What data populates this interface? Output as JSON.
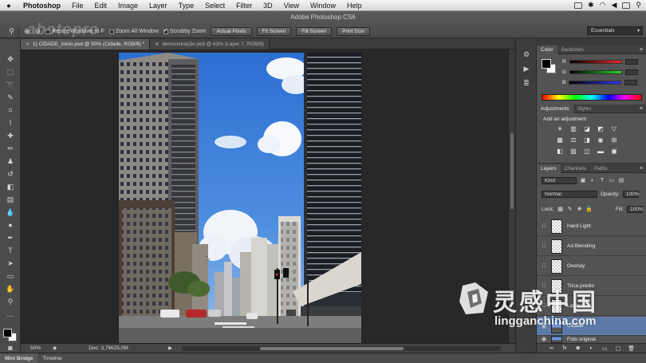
{
  "menubar": {
    "app": "Photoshop",
    "items": [
      "File",
      "Edit",
      "Image",
      "Layer",
      "Type",
      "Select",
      "Filter",
      "3D",
      "View",
      "Window",
      "Help"
    ]
  },
  "titlebar": {
    "title": "Adobe Photoshop CS6"
  },
  "watermark_top": "abotopro",
  "options": {
    "resize_windows": "Resize Windows to F",
    "zoom_all": "Zoom All Window",
    "scrubby": "Scrubby Zoom",
    "actual_pixels": "Actual Pixels",
    "fit_screen": "Fit Screen",
    "fill_screen": "Fill Screen",
    "print_size": "Print Size",
    "workspace": "Essentials"
  },
  "tabs": [
    {
      "label": "1) CIDADE_inicio.psd @ 50% (Cidade, RGB/8) *",
      "active": true
    },
    {
      "label": "demonstração.psd @ 63% (Layer 7, RGB/8)",
      "active": false
    }
  ],
  "status": {
    "zoom": "50%",
    "doc": "Doc: 3,7M/25,0M"
  },
  "bottom_tabs": [
    "Mini Bridge",
    "Timeline"
  ],
  "color_panel": {
    "tabs": [
      "Color",
      "Swatches"
    ],
    "channels": [
      "R",
      "G",
      "B"
    ]
  },
  "adjustments": {
    "tabs": [
      "Adjustments",
      "Styles"
    ],
    "title": "Add an adjustment"
  },
  "layers_panel": {
    "tabs": [
      "Layers",
      "Channels",
      "Paths"
    ],
    "filter": "Kind",
    "blend_mode": "Normal",
    "opacity_label": "Opacity:",
    "opacity": "100%",
    "lock_label": "Lock:",
    "fill_label": "Fill:",
    "fill": "100%",
    "layers": [
      {
        "name": "Hard Light",
        "selected": false
      },
      {
        "name": "Ad Blending",
        "selected": false
      },
      {
        "name": "Overlay",
        "selected": false
      },
      {
        "name": "Trica predio",
        "selected": false
      },
      {
        "name": "Layer 1",
        "selected": false
      },
      {
        "name": "Cidade",
        "selected": true
      },
      {
        "name": "Foto original",
        "selected": false
      }
    ]
  },
  "watermark": {
    "cn": "灵感中国",
    "en": "lingganchina.com"
  },
  "colors": {
    "selected_layer": "#5c7aa8",
    "sky": "#3f7fd6",
    "panel": "#535353"
  }
}
